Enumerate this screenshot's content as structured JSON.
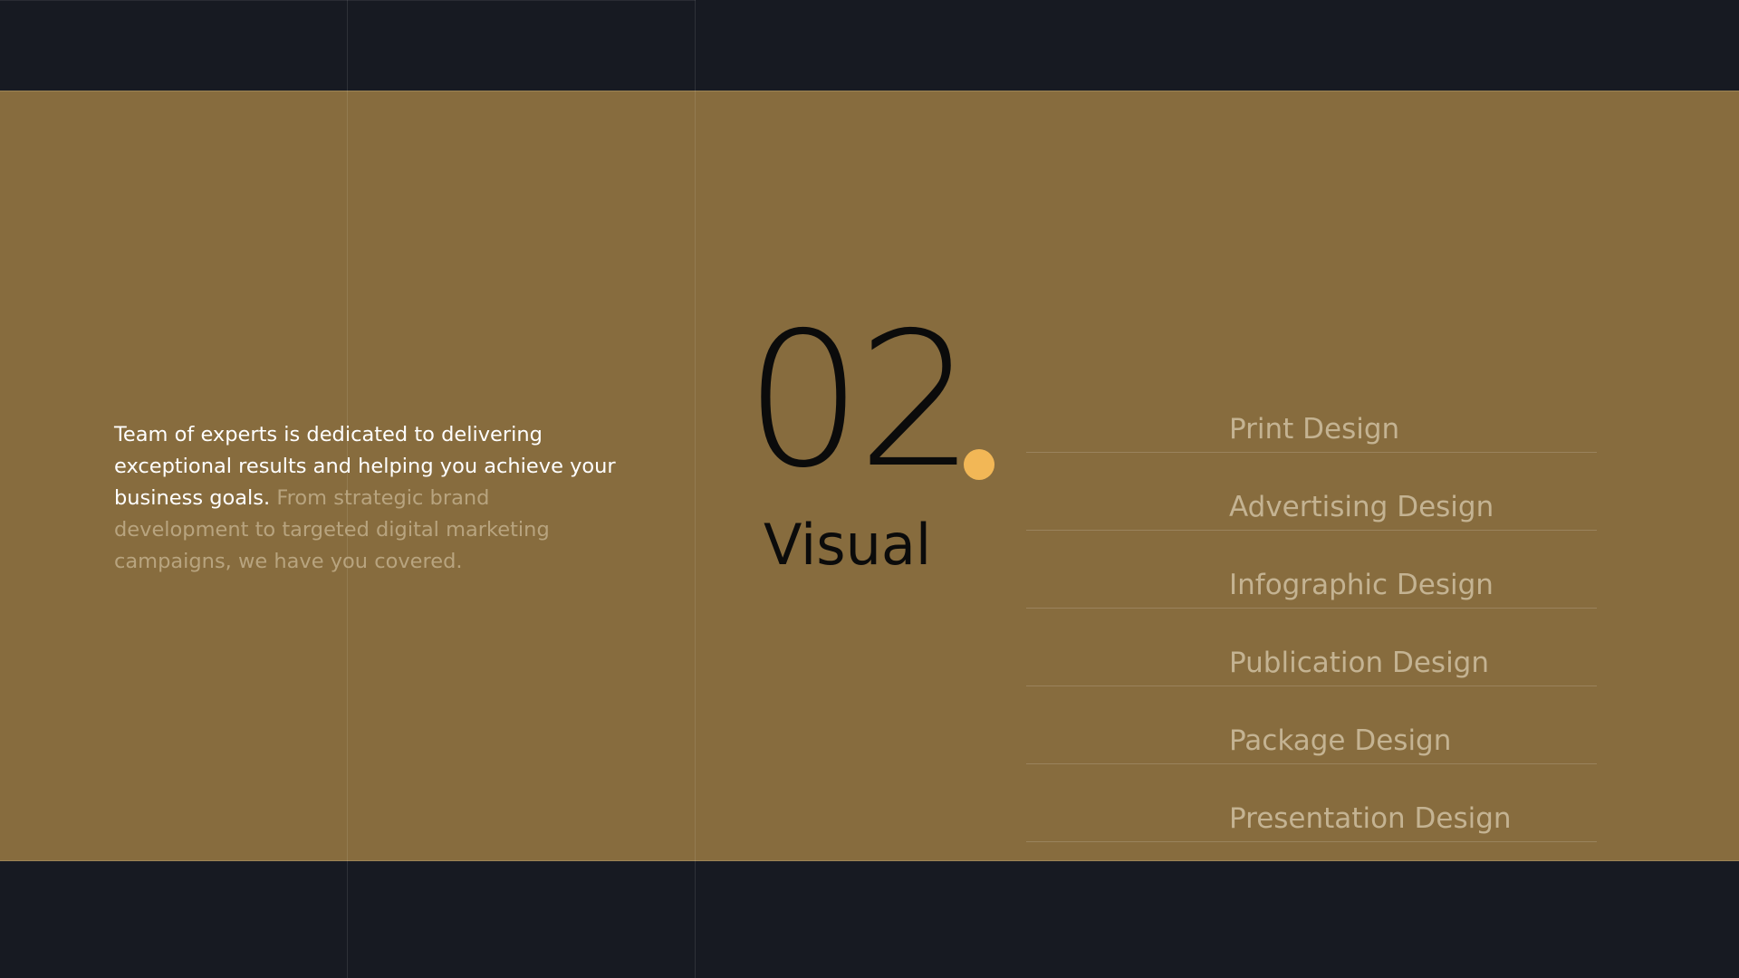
{
  "intro": {
    "lead": "Team of experts is dedicated to delivering exceptional results and helping you achieve your business goals.",
    "rest": "From strategic brand development to targeted digital marketing campaigns, we have you covered."
  },
  "section": {
    "number": "02",
    "title": "Visual"
  },
  "services": [
    {
      "label": "Print Design"
    },
    {
      "label": "Advertising Design"
    },
    {
      "label": "Infographic Design"
    },
    {
      "label": "Publication Design"
    },
    {
      "label": "Package Design"
    },
    {
      "label": "Presentation Design"
    }
  ],
  "colors": {
    "background": "#171a22",
    "band": "#876c3e",
    "accent_dot": "#f2b756",
    "heading": "#0b0b0b",
    "service_text": "#c4b392",
    "lead_text": "#ffffff",
    "muted_text": "#b8a47f"
  }
}
